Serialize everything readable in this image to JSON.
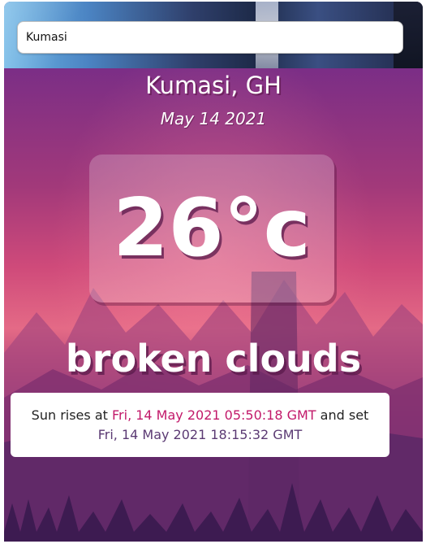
{
  "search": {
    "value": "Kumasi",
    "placeholder": ""
  },
  "weather": {
    "location": "Kumasi, GH",
    "date": "May 14 2021",
    "temperature": "26°c",
    "conditions": "broken clouds"
  },
  "sun": {
    "prefix_rise": "Sun rises at",
    "sunrise": "Fri, 14 May 2021 05:50:18 GMT",
    "prefix_set": "and set",
    "sunset": "Fri, 14 May 2021 18:15:32 GMT"
  },
  "colors": {
    "accent": "#c2196a",
    "sunset_text": "#5b3a73",
    "background_purple": "#7b2e86",
    "background_pink": "#e46a86"
  }
}
